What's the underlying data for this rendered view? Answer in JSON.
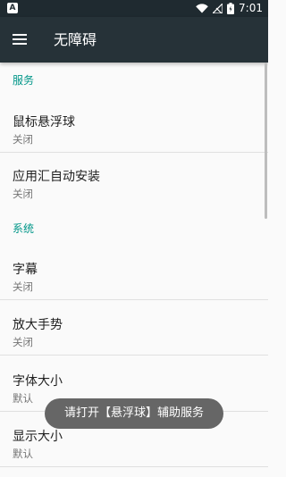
{
  "status_bar": {
    "notification_glyph": "A",
    "time": "7:01",
    "icons": [
      "wifi-icon",
      "signal-icon",
      "battery-icon"
    ]
  },
  "app_bar": {
    "menu_icon": "menu-icon",
    "title": "无障碍"
  },
  "sections": [
    {
      "header": "服务",
      "items": [
        {
          "title": "鼠标悬浮球",
          "summary": "关闭"
        },
        {
          "title": "应用汇自动安装",
          "summary": "关闭"
        }
      ]
    },
    {
      "header": "系统",
      "items": [
        {
          "title": "字幕",
          "summary": "关闭"
        },
        {
          "title": "放大手势",
          "summary": "关闭"
        },
        {
          "title": "字体大小",
          "summary": "默认"
        },
        {
          "title": "显示大小",
          "summary": "默认"
        }
      ]
    }
  ],
  "toast": {
    "text": "请打开【悬浮球】辅助服务"
  },
  "colors": {
    "status_bar": "#1f2a30",
    "app_bar": "#263238",
    "section_header": "#009688",
    "background": "#fafafa",
    "toast": "#666666"
  }
}
